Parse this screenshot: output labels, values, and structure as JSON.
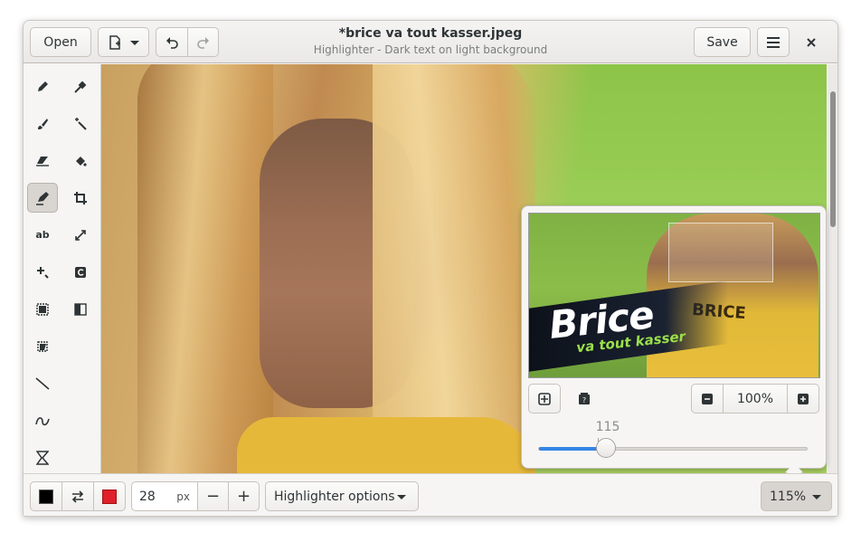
{
  "window": {
    "title": "*brice va tout kasser.jpeg",
    "subtitle": "Highlighter - Dark text on light background"
  },
  "header": {
    "open_label": "Open",
    "save_label": "Save"
  },
  "toolbar": {
    "tools": [
      {
        "name": "pencil-tool",
        "glyph": "✎"
      },
      {
        "name": "color-picker-tool",
        "glyph": "⁄"
      },
      {
        "name": "brush-tool",
        "glyph": "🖌"
      },
      {
        "name": "magic-wand-tool",
        "glyph": "✦"
      },
      {
        "name": "eraser-tool",
        "glyph": "⌫"
      },
      {
        "name": "paint-bucket-tool",
        "glyph": "◈"
      },
      {
        "name": "highlighter-tool",
        "glyph": "✐"
      },
      {
        "name": "crop-tool",
        "glyph": "⌗"
      },
      {
        "name": "text-tool",
        "glyph": "ab"
      },
      {
        "name": "scale-tool",
        "glyph": "⤢"
      },
      {
        "name": "transform-tool",
        "glyph": "✚"
      },
      {
        "name": "rotate-tool",
        "glyph": "↻"
      },
      {
        "name": "rectangle-selection-tool",
        "glyph": "▣"
      },
      {
        "name": "filters-tool",
        "glyph": "◧"
      },
      {
        "name": "free-selection-tool",
        "glyph": "▨"
      },
      {
        "name": "line-tool",
        "glyph": "╲"
      },
      {
        "name": "curve-tool",
        "glyph": "∽"
      },
      {
        "name": "shape-tool",
        "glyph": "⌛"
      }
    ]
  },
  "bottom": {
    "size_value": "28",
    "size_unit": "px",
    "minus_label": "−",
    "plus_label": "+",
    "options_label": "Highlighter options",
    "zoom_label": "115%",
    "primary_color": "#000000",
    "secondary_color": "#e0202a"
  },
  "popover": {
    "zoom_percent": "100%",
    "slider_value": "115",
    "slider_fraction": 0.25,
    "preview_title": "Brice",
    "preview_subtitle": "va tout kasser",
    "preview_shirt_text": "BRICE"
  },
  "colors": {
    "accent": "#3584e4",
    "canvas_green": "#9ccf58"
  }
}
